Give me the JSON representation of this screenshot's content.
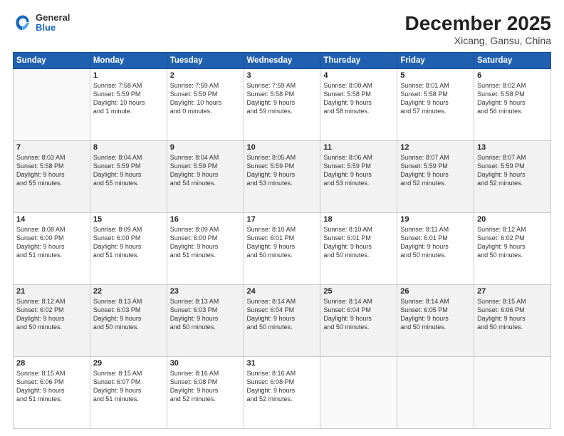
{
  "header": {
    "logo_general": "General",
    "logo_blue": "Blue",
    "title": "December 2025",
    "subtitle": "Xicang, Gansu, China"
  },
  "weekdays": [
    "Sunday",
    "Monday",
    "Tuesday",
    "Wednesday",
    "Thursday",
    "Friday",
    "Saturday"
  ],
  "rows": [
    [
      {
        "day": "",
        "lines": []
      },
      {
        "day": "1",
        "lines": [
          "Sunrise: 7:58 AM",
          "Sunset: 5:59 PM",
          "Daylight: 10 hours",
          "and 1 minute."
        ]
      },
      {
        "day": "2",
        "lines": [
          "Sunrise: 7:59 AM",
          "Sunset: 5:59 PM",
          "Daylight: 10 hours",
          "and 0 minutes."
        ]
      },
      {
        "day": "3",
        "lines": [
          "Sunrise: 7:59 AM",
          "Sunset: 5:58 PM",
          "Daylight: 9 hours",
          "and 59 minutes."
        ]
      },
      {
        "day": "4",
        "lines": [
          "Sunrise: 8:00 AM",
          "Sunset: 5:58 PM",
          "Daylight: 9 hours",
          "and 58 minutes."
        ]
      },
      {
        "day": "5",
        "lines": [
          "Sunrise: 8:01 AM",
          "Sunset: 5:58 PM",
          "Daylight: 9 hours",
          "and 57 minutes."
        ]
      },
      {
        "day": "6",
        "lines": [
          "Sunrise: 8:02 AM",
          "Sunset: 5:58 PM",
          "Daylight: 9 hours",
          "and 56 minutes."
        ]
      }
    ],
    [
      {
        "day": "7",
        "lines": [
          "Sunrise: 8:03 AM",
          "Sunset: 5:58 PM",
          "Daylight: 9 hours",
          "and 55 minutes."
        ]
      },
      {
        "day": "8",
        "lines": [
          "Sunrise: 8:04 AM",
          "Sunset: 5:59 PM",
          "Daylight: 9 hours",
          "and 55 minutes."
        ]
      },
      {
        "day": "9",
        "lines": [
          "Sunrise: 8:04 AM",
          "Sunset: 5:59 PM",
          "Daylight: 9 hours",
          "and 54 minutes."
        ]
      },
      {
        "day": "10",
        "lines": [
          "Sunrise: 8:05 AM",
          "Sunset: 5:59 PM",
          "Daylight: 9 hours",
          "and 53 minutes."
        ]
      },
      {
        "day": "11",
        "lines": [
          "Sunrise: 8:06 AM",
          "Sunset: 5:59 PM",
          "Daylight: 9 hours",
          "and 53 minutes."
        ]
      },
      {
        "day": "12",
        "lines": [
          "Sunrise: 8:07 AM",
          "Sunset: 5:59 PM",
          "Daylight: 9 hours",
          "and 52 minutes."
        ]
      },
      {
        "day": "13",
        "lines": [
          "Sunrise: 8:07 AM",
          "Sunset: 5:59 PM",
          "Daylight: 9 hours",
          "and 52 minutes."
        ]
      }
    ],
    [
      {
        "day": "14",
        "lines": [
          "Sunrise: 8:08 AM",
          "Sunset: 6:00 PM",
          "Daylight: 9 hours",
          "and 51 minutes."
        ]
      },
      {
        "day": "15",
        "lines": [
          "Sunrise: 8:09 AM",
          "Sunset: 6:00 PM",
          "Daylight: 9 hours",
          "and 51 minutes."
        ]
      },
      {
        "day": "16",
        "lines": [
          "Sunrise: 8:09 AM",
          "Sunset: 6:00 PM",
          "Daylight: 9 hours",
          "and 51 minutes."
        ]
      },
      {
        "day": "17",
        "lines": [
          "Sunrise: 8:10 AM",
          "Sunset: 6:01 PM",
          "Daylight: 9 hours",
          "and 50 minutes."
        ]
      },
      {
        "day": "18",
        "lines": [
          "Sunrise: 8:10 AM",
          "Sunset: 6:01 PM",
          "Daylight: 9 hours",
          "and 50 minutes."
        ]
      },
      {
        "day": "19",
        "lines": [
          "Sunrise: 8:11 AM",
          "Sunset: 6:01 PM",
          "Daylight: 9 hours",
          "and 50 minutes."
        ]
      },
      {
        "day": "20",
        "lines": [
          "Sunrise: 8:12 AM",
          "Sunset: 6:02 PM",
          "Daylight: 9 hours",
          "and 50 minutes."
        ]
      }
    ],
    [
      {
        "day": "21",
        "lines": [
          "Sunrise: 8:12 AM",
          "Sunset: 6:02 PM",
          "Daylight: 9 hours",
          "and 50 minutes."
        ]
      },
      {
        "day": "22",
        "lines": [
          "Sunrise: 8:13 AM",
          "Sunset: 6:03 PM",
          "Daylight: 9 hours",
          "and 50 minutes."
        ]
      },
      {
        "day": "23",
        "lines": [
          "Sunrise: 8:13 AM",
          "Sunset: 6:03 PM",
          "Daylight: 9 hours",
          "and 50 minutes."
        ]
      },
      {
        "day": "24",
        "lines": [
          "Sunrise: 8:14 AM",
          "Sunset: 6:04 PM",
          "Daylight: 9 hours",
          "and 50 minutes."
        ]
      },
      {
        "day": "25",
        "lines": [
          "Sunrise: 8:14 AM",
          "Sunset: 6:04 PM",
          "Daylight: 9 hours",
          "and 50 minutes."
        ]
      },
      {
        "day": "26",
        "lines": [
          "Sunrise: 8:14 AM",
          "Sunset: 6:05 PM",
          "Daylight: 9 hours",
          "and 50 minutes."
        ]
      },
      {
        "day": "27",
        "lines": [
          "Sunrise: 8:15 AM",
          "Sunset: 6:06 PM",
          "Daylight: 9 hours",
          "and 50 minutes."
        ]
      }
    ],
    [
      {
        "day": "28",
        "lines": [
          "Sunrise: 8:15 AM",
          "Sunset: 6:06 PM",
          "Daylight: 9 hours",
          "and 51 minutes."
        ]
      },
      {
        "day": "29",
        "lines": [
          "Sunrise: 8:15 AM",
          "Sunset: 6:07 PM",
          "Daylight: 9 hours",
          "and 51 minutes."
        ]
      },
      {
        "day": "30",
        "lines": [
          "Sunrise: 8:16 AM",
          "Sunset: 6:08 PM",
          "Daylight: 9 hours",
          "and 52 minutes."
        ]
      },
      {
        "day": "31",
        "lines": [
          "Sunrise: 8:16 AM",
          "Sunset: 6:08 PM",
          "Daylight: 9 hours",
          "and 52 minutes."
        ]
      },
      {
        "day": "",
        "lines": []
      },
      {
        "day": "",
        "lines": []
      },
      {
        "day": "",
        "lines": []
      }
    ]
  ]
}
